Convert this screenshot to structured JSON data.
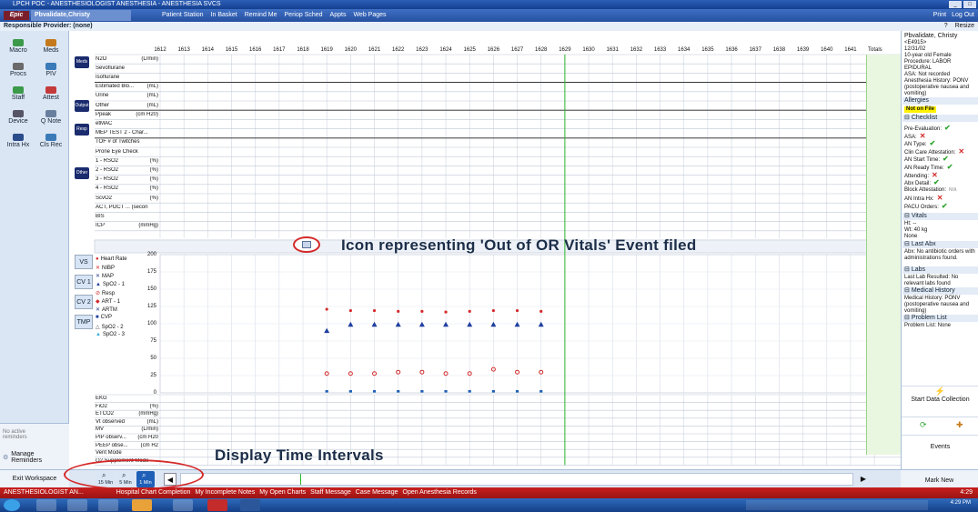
{
  "titlebar": {
    "title": "LPCH POC - ANESTHESIOLOGIST ANESTHESIA - ANESTHESIA SVCS"
  },
  "toolbar": {
    "epic_label": "Epic",
    "patient_tab": "Pbvalidate,Christy",
    "items": [
      "Patient Station",
      "In Basket",
      "Remind Me",
      "Periop Sched",
      "Appts",
      "Web Pages"
    ],
    "right_items": [
      "Print",
      "Log Out"
    ]
  },
  "responsible_provider": "Responsible Provider: (none)",
  "resize_label": "Resize",
  "help_label": "?",
  "activities": [
    {
      "label": "Macro"
    },
    {
      "label": "Meds"
    },
    {
      "label": "Procs"
    },
    {
      "label": "PIV"
    },
    {
      "label": "Staff"
    },
    {
      "label": "Attest"
    },
    {
      "label": "Device"
    },
    {
      "label": "Q Note"
    },
    {
      "label": "Intra Hx"
    },
    {
      "label": "Cls Rec"
    }
  ],
  "nav_bottom": {
    "no_reminders": "No active reminders",
    "manage": "Manage Reminders",
    "exit": "Exit Workspace"
  },
  "view_buttons": [
    "Meds",
    "Output",
    "Resp",
    "Other"
  ],
  "time_headers": [
    "1612",
    "1613",
    "1614",
    "1615",
    "1616",
    "1617",
    "1618",
    "1619",
    "1620",
    "1621",
    "1622",
    "1623",
    "1624",
    "1625",
    "1626",
    "1627",
    "1628",
    "1629",
    "1630",
    "1631",
    "1632",
    "1633",
    "1634",
    "1635",
    "1636",
    "1637",
    "1638",
    "1639",
    "1640",
    "1641"
  ],
  "totals_label": "Totals",
  "upper_rows": [
    {
      "label": "N2O",
      "unit": "(L/min)"
    },
    {
      "label": "Sevoflurane",
      "unit": ""
    },
    {
      "label": "Isoflurane",
      "unit": ""
    },
    {
      "label": "Estimated Blo...",
      "unit": "(mL)"
    },
    {
      "label": "Urine",
      "unit": "(mL)"
    },
    {
      "label": "Other",
      "unit": "(mL)"
    },
    {
      "label": "Ppeak",
      "unit": "(cm H20)"
    },
    {
      "label": "etMAC",
      "unit": ""
    },
    {
      "label": "MEP TEST 2 - Char...",
      "unit": ""
    },
    {
      "label": "TOF # of Twitches",
      "unit": ""
    },
    {
      "label": "Prone Eye Check",
      "unit": ""
    },
    {
      "label": "1 - RSO2",
      "unit": "(%)"
    },
    {
      "label": "2 - RSO2",
      "unit": "(%)"
    },
    {
      "label": "3 - RSO2",
      "unit": "(%)"
    },
    {
      "label": "4 - RSO2",
      "unit": "(%)"
    },
    {
      "label": "ScvO2",
      "unit": "(%)"
    },
    {
      "label": "ACT, POCT ... (secon",
      "unit": ""
    },
    {
      "label": "BIS",
      "unit": ""
    },
    {
      "label": "ICP",
      "unit": "(mmHg)"
    }
  ],
  "vitals_tabs": [
    "VS",
    "CV 1",
    "CV 2",
    "TMP"
  ],
  "legend": [
    "Heart Rate",
    "NIBP",
    "MAP",
    "SpO2 - 1",
    "Resp",
    "ART - 1",
    "ARTM",
    "CVP",
    "SpO2 - 2",
    "SpO2 - 3"
  ],
  "y_ticks": [
    "200",
    "175",
    "150",
    "125",
    "100",
    "75",
    "50",
    "25",
    "0"
  ],
  "lower_rows": [
    {
      "label": "EKG",
      "unit": ""
    },
    {
      "label": "FiO2",
      "unit": "(%)"
    },
    {
      "label": "ETCO2",
      "unit": "(mmHg)"
    },
    {
      "label": "Vt observed",
      "unit": "(mL)"
    },
    {
      "label": "MV",
      "unit": "(L/min)"
    },
    {
      "label": "PIP observ...",
      "unit": "(cm H20"
    },
    {
      "label": "PEEP obse...",
      "unit": "(cm H2"
    },
    {
      "label": "Vent Mode",
      "unit": ""
    },
    {
      "label": "O2 Supplement Mode",
      "unit": ""
    }
  ],
  "interval_buttons": [
    "15 Min",
    "5 Min",
    "1 Min"
  ],
  "callouts": {
    "vitals_event": "Icon representing 'Out of OR Vitals' Event filed",
    "intervals": "Display Time Intervals"
  },
  "right_panel": {
    "patient_name": "Pbvalidate, Christy",
    "mrn": "<E4915>",
    "dob": "12/31/02",
    "age": "10-year old Female",
    "procedure": "Procedure: LABOR EPIDURAL",
    "asa": "ASA: Not recorded",
    "anesth_history": "Anesthesia History: PONV (postoperative nausea and vomiting)",
    "allergies_title": "Allergies",
    "allergies_value": "Not on File",
    "checklist_title": "Checklist",
    "checklist": [
      {
        "label": "Pre-Evaluation:",
        "status": "check"
      },
      {
        "label": "ASA:",
        "status": "x"
      },
      {
        "label": "AN Type:",
        "status": "check"
      },
      {
        "label": "Clin Care Attestation:",
        "status": "x"
      },
      {
        "label": "AN Start Time:",
        "status": "check"
      },
      {
        "label": "AN Ready Time:",
        "status": "check"
      },
      {
        "label": "Attending:",
        "status": "x"
      },
      {
        "label": "Abx Detail:",
        "status": "check"
      },
      {
        "label": "Block Attestation:",
        "status": "na"
      },
      {
        "label": "AN Intra Hx:",
        "status": "x"
      },
      {
        "label": "PACU Orders:",
        "status": "check"
      }
    ],
    "vitals_title": "Vitals",
    "vitals": [
      "Ht: --",
      "Wt: 40 kg",
      "None"
    ],
    "last_abx_title": "Last Abx",
    "last_abx": "Abx: No antibiotic orders with administrations found.",
    "labs_title": "Labs",
    "labs": "Last Lab Resulted: No relevant labs found",
    "medhx_title": "Medical History",
    "medhx": "Medical History: PONV (postoperative nausea and vomiting)",
    "problems_title": "Problem List",
    "problems": "Problem List: None",
    "start_collection": "Start Data Collection",
    "events": "Events",
    "mark_new": "Mark New"
  },
  "statusbar": {
    "role": "ANESTHESIOLOGIST AN...",
    "items": [
      "Hospital Chart Completion",
      "My Incomplete Notes",
      "My Open Charts",
      "Staff Message",
      "Case Message",
      "Open Anesthesia Records"
    ],
    "time": "4:29"
  },
  "taskbar": {
    "clock": "4:29 PM"
  },
  "chart_data": {
    "type": "scatter",
    "x": [
      "1619",
      "1620",
      "1621",
      "1622",
      "1623",
      "1624",
      "1625",
      "1626",
      "1627",
      "1628"
    ],
    "series": [
      {
        "name": "Heart Rate",
        "values": [
          121,
          119,
          119,
          118,
          118,
          117,
          118,
          119,
          119,
          118
        ]
      },
      {
        "name": "SpO2 - 1",
        "values": [
          90,
          99,
          99,
          99,
          99,
          99,
          99,
          99,
          99,
          99
        ]
      },
      {
        "name": "Resp",
        "values": [
          28,
          28,
          28,
          30,
          30,
          28,
          28,
          34,
          30,
          30
        ]
      },
      {
        "name": "CVP",
        "values": [
          0,
          0,
          0,
          0,
          0,
          0,
          0,
          0,
          0,
          0
        ]
      }
    ],
    "ylim": [
      0,
      200
    ],
    "grid": true
  }
}
